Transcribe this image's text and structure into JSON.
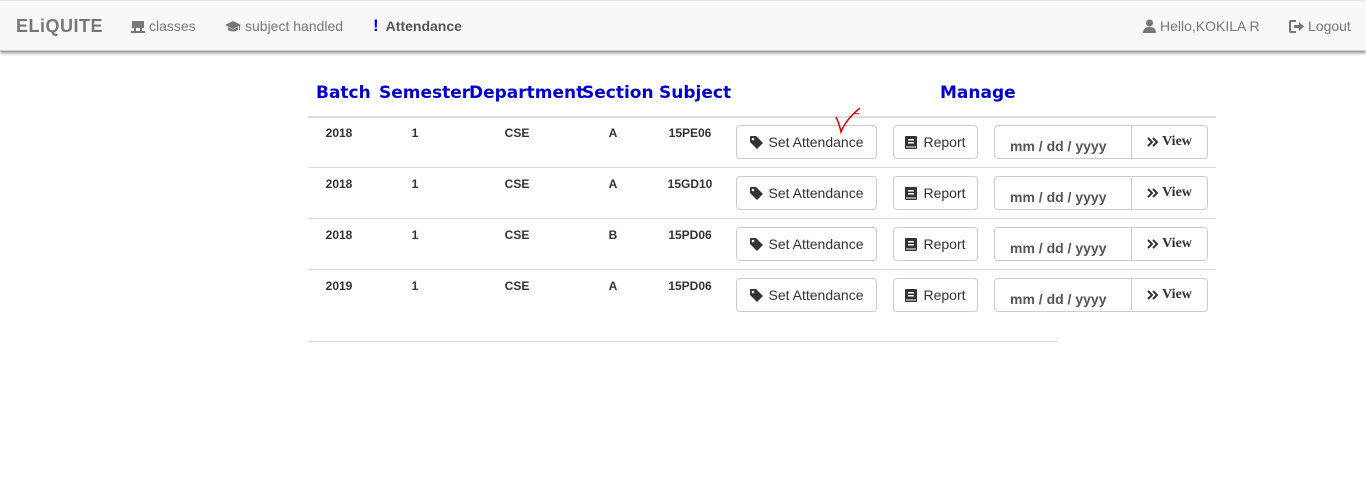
{
  "navbar": {
    "brand": "ELiQUITE",
    "items": [
      {
        "label": "classes",
        "icon": "desk-icon"
      },
      {
        "label": "subject handled",
        "icon": "graduation-cap-icon"
      },
      {
        "label": "Attendance",
        "icon": "exclamation-icon",
        "active": true
      }
    ],
    "user_greeting": "Hello,KOKILA R",
    "logout_label": "Logout"
  },
  "table": {
    "headers": {
      "batch": "Batch",
      "semester": "Semester",
      "department": "Department",
      "section": "Section",
      "subject": "Subject",
      "manage": "Manage"
    },
    "rows": [
      {
        "batch": "2018",
        "semester": "1",
        "department": "CSE",
        "section": "A",
        "subject": "15PE06"
      },
      {
        "batch": "2018",
        "semester": "1",
        "department": "CSE",
        "section": "A",
        "subject": "15GD10"
      },
      {
        "batch": "2018",
        "semester": "1",
        "department": "CSE",
        "section": "B",
        "subject": "15PD06"
      },
      {
        "batch": "2019",
        "semester": "1",
        "department": "CSE",
        "section": "A",
        "subject": "15PD06"
      }
    ],
    "actions": {
      "set_attendance": "Set Attendance",
      "report": "Report",
      "date_placeholder": "mm / dd / yyyy",
      "view": "View"
    }
  },
  "colors": {
    "header_text": "#0000cc",
    "annotation": "#e00000"
  }
}
